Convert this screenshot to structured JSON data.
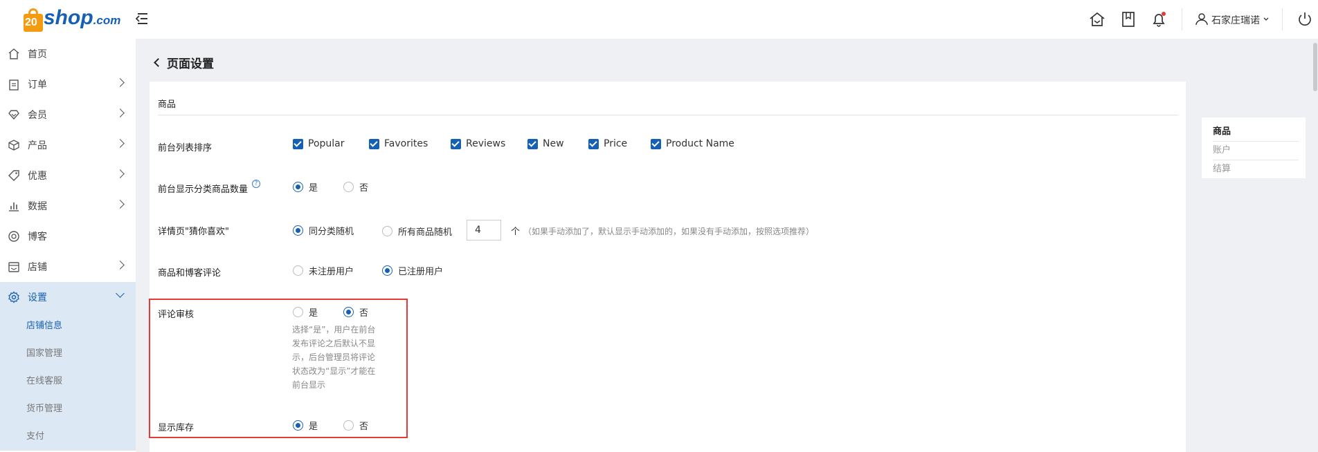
{
  "header": {
    "logo_num": "20",
    "logo_text": "shop",
    "logo_suffix": ".com",
    "user_name": "石家庄瑞诺",
    "icons": [
      "home-icon",
      "bookmark-icon",
      "bell-icon",
      "user-icon",
      "power-icon"
    ],
    "notification_dot_color": "#e53935"
  },
  "sidebar": {
    "items": [
      {
        "label": "首页",
        "icon": "home-icon"
      },
      {
        "label": "订单",
        "icon": "clipboard-icon"
      },
      {
        "label": "会员",
        "icon": "diamond-icon"
      },
      {
        "label": "产品",
        "icon": "cube-icon"
      },
      {
        "label": "优惠",
        "icon": "tag-icon"
      },
      {
        "label": "数据",
        "icon": "bar-chart-icon"
      },
      {
        "label": "博客",
        "icon": "blog-icon"
      },
      {
        "label": "店铺",
        "icon": "store-icon"
      },
      {
        "label": "设置",
        "icon": "gear-icon"
      }
    ],
    "sub_items": [
      "店铺信息",
      "国家管理",
      "在线客服",
      "货币管理",
      "支付"
    ]
  },
  "page": {
    "title": "页面设置",
    "section_title": "商品"
  },
  "form": {
    "sort": {
      "label": "前台列表排序",
      "options": [
        "Popular",
        "Favorites",
        "Reviews",
        "New",
        "Price",
        "Product Name"
      ]
    },
    "show_count": {
      "label": "前台显示分类商品数量",
      "help": "?",
      "yes": "是",
      "no": "否",
      "selected": "是"
    },
    "guess_like": {
      "label": "详情页\"猜你喜欢\"",
      "opt1": "同分类随机",
      "opt2": "所有商品随机",
      "count": "4",
      "unit": "个",
      "hint": "（如果手动添加了，默认显示手动添加的，如果没有手动添加，按照选项推荐）",
      "selected": "同分类随机"
    },
    "review_comment": {
      "label": "商品和博客评论",
      "opt1": "未注册用户",
      "opt2": "已注册用户",
      "selected": "已注册用户"
    },
    "review_audit": {
      "label": "评论审核",
      "yes": "是",
      "no": "否",
      "selected": "否",
      "desc": "选择“是”，用户在前台发布评论之后默认不显示，后台管理员将评论状态改为“显示”才能在前台显示"
    },
    "show_stock": {
      "label": "显示库存",
      "yes": "是",
      "no": "否",
      "selected": "是"
    }
  },
  "anchor_nav": [
    "商品",
    "账户",
    "结算"
  ],
  "colors": {
    "accent": "#1660b3",
    "logo_orange": "#f39c12",
    "highlight": "#e53935"
  }
}
